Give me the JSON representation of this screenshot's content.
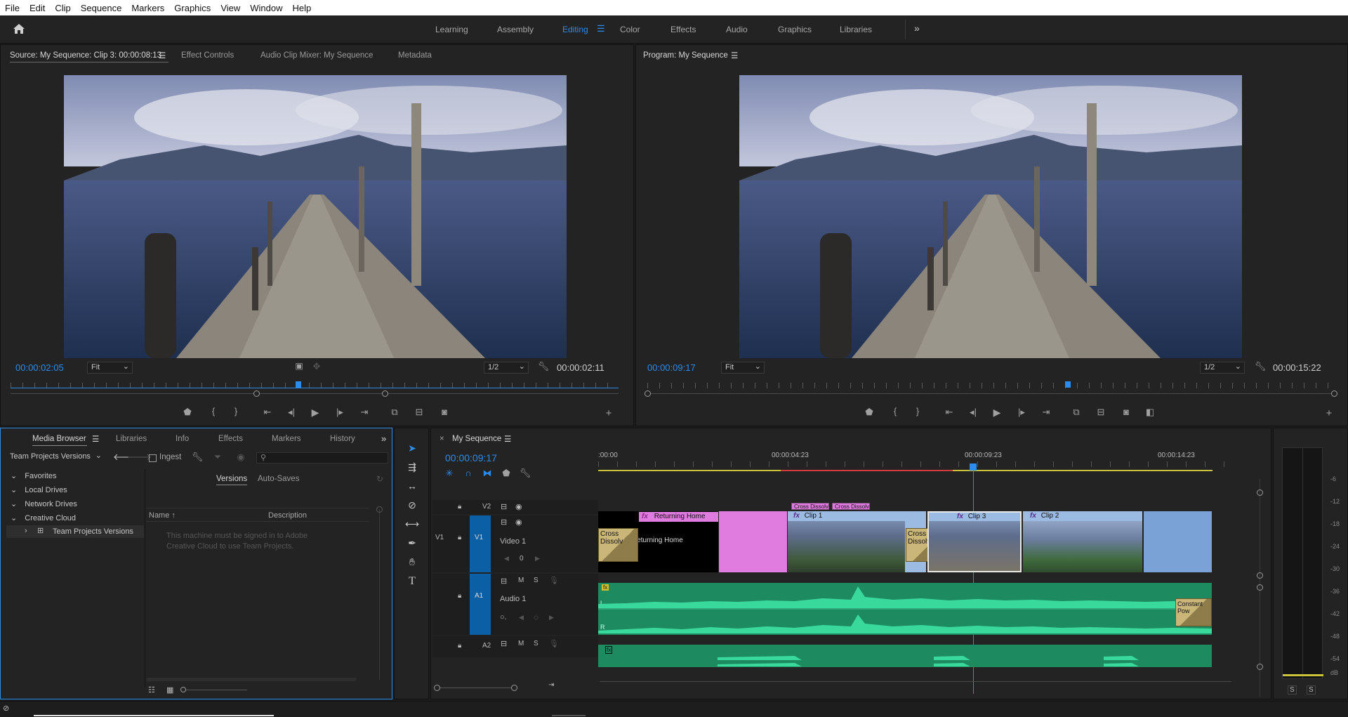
{
  "menubar": {
    "items": [
      "File",
      "Edit",
      "Clip",
      "Sequence",
      "Markers",
      "Graphics",
      "View",
      "Window",
      "Help"
    ]
  },
  "workspaces": {
    "items": [
      "Learning",
      "Assembly",
      "Editing",
      "Color",
      "Effects",
      "Audio",
      "Graphics",
      "Libraries"
    ],
    "active": "Editing",
    "overflow_icon": "double-chevron-right-icon"
  },
  "source_monitor": {
    "tabs": [
      "Source: My Sequence: Clip 3: 00:00:08:13",
      "Effect Controls",
      "Audio Clip Mixer: My Sequence",
      "Metadata"
    ],
    "timecode": "00:00:02:05",
    "zoom": "Fit",
    "resolution": "1/2",
    "duration": "00:00:02:11"
  },
  "program_monitor": {
    "tab": "Program: My Sequence",
    "timecode": "00:00:09:17",
    "zoom": "Fit",
    "resolution": "1/2",
    "duration": "00:00:15:22"
  },
  "transport": {
    "buttons": [
      "marker-icon",
      "mark-in-icon",
      "mark-out-icon",
      "go-to-in-icon",
      "step-back-icon",
      "play-icon",
      "step-forward-icon",
      "go-to-out-icon",
      "insert-icon",
      "overwrite-icon",
      "export-frame-icon",
      "add-icon"
    ]
  },
  "media_browser": {
    "tabs": [
      "Media Browser",
      "Libraries",
      "Info",
      "Effects",
      "Markers",
      "History"
    ],
    "location": "Team Projects Versions",
    "ingest_label": "Ingest",
    "tree": [
      "Favorites",
      "Local Drives",
      "Network Drives",
      "Creative Cloud",
      "Team Projects Versions"
    ],
    "subtabs": [
      "Versions",
      "Auto-Saves"
    ],
    "columns": [
      "Name",
      "Description"
    ],
    "message": "This machine must be signed in to Adobe Creative Cloud to use Team Projects."
  },
  "timeline": {
    "tab": "My Sequence",
    "timecode": "00:00:09:17",
    "ruler_labels": [
      ":00:00",
      "00:00:04:23",
      "00:00:09:23",
      "00:00:14:23"
    ],
    "tracks": {
      "v2": "V2",
      "v1": "V1",
      "v1_target": "V1",
      "v1_name": "Video 1",
      "v1_value": "0",
      "a1": "A1",
      "a1_name": "Audio 1",
      "a2": "A2",
      "m": "M",
      "s": "S"
    },
    "clips": {
      "returning_home": "Returning Home",
      "returning_home_body": "Returning Home",
      "clip1": "Clip 1",
      "clip3": "Clip 3",
      "clip2": "Clip 2",
      "cross_dissolve_1": "Cross Dissolv",
      "cross_dissolve_2": "Cross Dissolve",
      "v2_dissolve_1": "Cross Dissolv",
      "v2_dissolve_2": "Cross Dissolv",
      "constant_power": "Constant Pow",
      "fx": "fx"
    },
    "audio_channels": [
      "L",
      "R"
    ]
  },
  "audio_meter": {
    "labels": [
      "-6",
      "-12",
      "-18",
      "-24",
      "-30",
      "-36",
      "-42",
      "-48",
      "-54",
      "dB"
    ],
    "solo": [
      "S",
      "S"
    ]
  },
  "tools": [
    "selection-tool-icon",
    "track-select-tool-icon",
    "ripple-edit-tool-icon",
    "razor-tool-icon",
    "slip-tool-icon",
    "pen-tool-icon",
    "hand-tool-icon",
    "type-tool-icon"
  ],
  "colors": {
    "accent": "#2d8ceb",
    "audio_clip": "#2dbf88",
    "video_clip": "#9bbbe3",
    "pink_clip": "#e07be0",
    "target_blue": "#0b5fa5"
  }
}
